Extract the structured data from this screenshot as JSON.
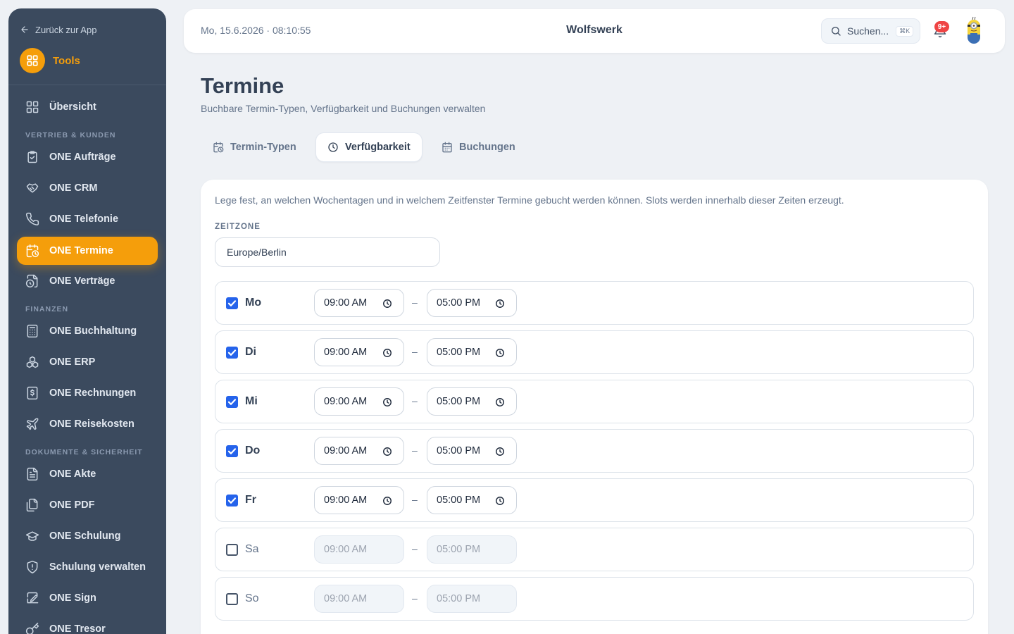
{
  "sidebar": {
    "back_label": "Zurück zur App",
    "tools_label": "Tools",
    "overview_label": "Übersicht",
    "section_sales": "Vertrieb & Kunden",
    "section_finance": "Finanzen",
    "section_docs": "Dokumente & Sicherheit",
    "items": [
      {
        "label": "ONE Aufträge",
        "icon": "clipboard-check-icon"
      },
      {
        "label": "ONE CRM",
        "icon": "handshake-icon"
      },
      {
        "label": "ONE Telefonie",
        "icon": "phone-icon"
      },
      {
        "label": "ONE Termine",
        "icon": "calendar-clock-icon",
        "active": true
      },
      {
        "label": "ONE Verträge",
        "icon": "file-clock-icon"
      },
      {
        "label": "ONE Buchhaltung",
        "icon": "calculator-icon"
      },
      {
        "label": "ONE ERP",
        "icon": "boxes-icon"
      },
      {
        "label": "ONE Rechnungen",
        "icon": "receipt-dollar-icon"
      },
      {
        "label": "ONE Reisekosten",
        "icon": "plane-icon"
      },
      {
        "label": "ONE Akte",
        "icon": "file-text-icon"
      },
      {
        "label": "ONE PDF",
        "icon": "files-icon"
      },
      {
        "label": "ONE Schulung",
        "icon": "graduation-cap-icon"
      },
      {
        "label": "Schulung verwalten",
        "icon": "shield-icon"
      },
      {
        "label": "ONE Sign",
        "icon": "signature-icon"
      },
      {
        "label": "ONE Tresor",
        "icon": "key-icon"
      }
    ]
  },
  "topbar": {
    "datetime": "Mo, 15.6.2026 · 08:10:55",
    "brand": "Wolfswerk",
    "search_placeholder": "Suchen...",
    "search_shortcut": "⌘K",
    "notification_count": "9+"
  },
  "page": {
    "title": "Termine",
    "subtitle": "Buchbare Termin-Typen, Verfügbarkeit und Buchungen verwalten"
  },
  "tabs": [
    {
      "label": "Termin-Typen",
      "icon": "calendar-clock-icon"
    },
    {
      "label": "Verfügbarkeit",
      "icon": "clock-icon",
      "active": true
    },
    {
      "label": "Buchungen",
      "icon": "calendar-icon"
    }
  ],
  "availability": {
    "intro": "Lege fest, an welchen Wochentagen und in welchem Zeitfenster Termine gebucht werden können. Slots werden innerhalb dieser Zeiten erzeugt.",
    "timezone_label": "ZEITZONE",
    "timezone_value": "Europe/Berlin",
    "separator": "–",
    "days": [
      {
        "name": "Mo",
        "enabled": true,
        "start": "09:00 AM",
        "end": "05:00 PM"
      },
      {
        "name": "Di",
        "enabled": true,
        "start": "09:00 AM",
        "end": "05:00 PM"
      },
      {
        "name": "Mi",
        "enabled": true,
        "start": "09:00 AM",
        "end": "05:00 PM"
      },
      {
        "name": "Do",
        "enabled": true,
        "start": "09:00 AM",
        "end": "05:00 PM"
      },
      {
        "name": "Fr",
        "enabled": true,
        "start": "09:00 AM",
        "end": "05:00 PM"
      },
      {
        "name": "Sa",
        "enabled": false,
        "start": "09:00 AM",
        "end": "05:00 PM"
      },
      {
        "name": "So",
        "enabled": false,
        "start": "09:00 AM",
        "end": "05:00 PM"
      }
    ]
  },
  "colors": {
    "accent": "#f59e0b",
    "sidebar_bg": "#3b4a5e",
    "checkbox": "#2563eb",
    "badge": "#ef4444"
  }
}
